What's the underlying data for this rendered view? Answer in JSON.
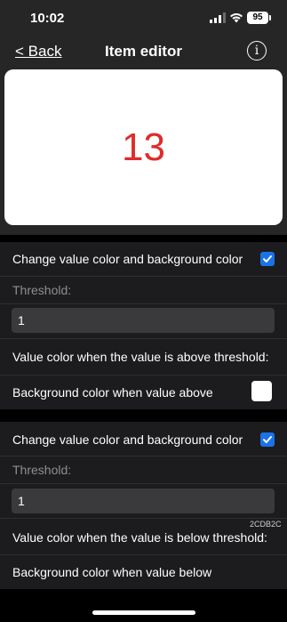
{
  "status_bar": {
    "time": "10:02",
    "battery": "95"
  },
  "nav": {
    "back_label": "< Back",
    "title": "Item editor",
    "info_label": "i"
  },
  "preview": {
    "value": "13",
    "value_color": "#e02b2b",
    "background_color": "#ffffff"
  },
  "above_section": {
    "toggle_label": "Change value color and background color",
    "toggle_checked": true,
    "threshold_label": "Threshold:",
    "threshold_value": "1",
    "value_color_label": "Value color when the value is above threshold:",
    "background_color_label": "Background color when value above",
    "background_color": "#ffffff"
  },
  "below_section": {
    "toggle_label": "Change value color and background color",
    "toggle_checked": true,
    "threshold_label": "Threshold:",
    "threshold_value": "1",
    "value_color_hex": "2CDB2C",
    "value_color_label": "Value color when the value is below threshold:",
    "background_color_label": "Background color when value below"
  },
  "colors": {
    "accent": "#1a73e8",
    "bar": "#262626",
    "row": "#1c1c1e"
  }
}
